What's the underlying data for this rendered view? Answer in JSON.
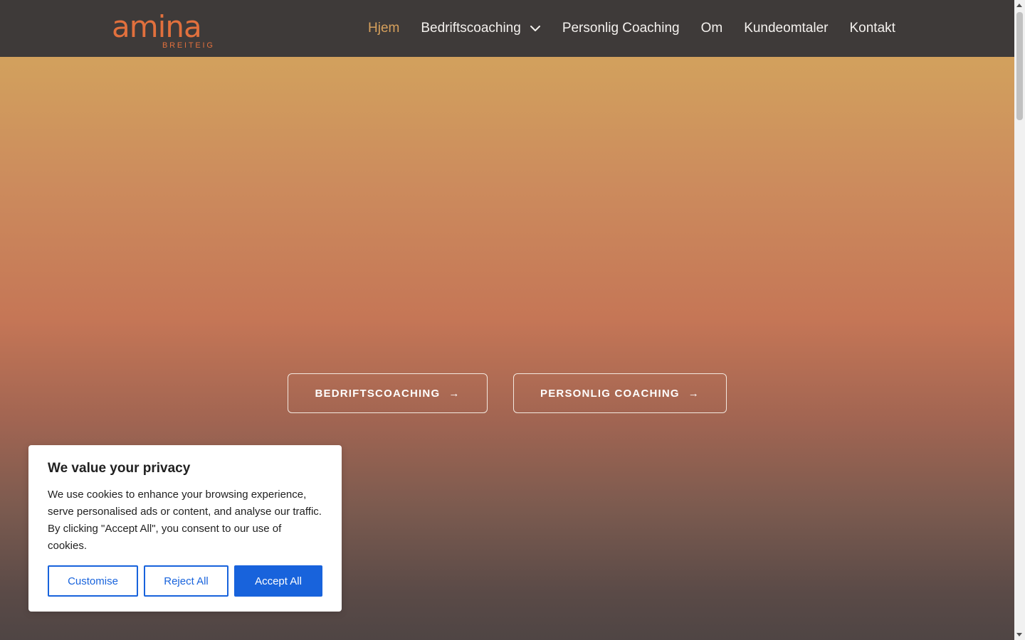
{
  "header": {
    "logo_word": "amina",
    "logo_sub": "BREITEIG",
    "nav": [
      {
        "label": "Hjem",
        "active": true
      },
      {
        "label": "Bedriftscoaching",
        "has_dropdown": true
      },
      {
        "label": "Personlig Coaching"
      },
      {
        "label": "Om"
      },
      {
        "label": "Kundeomtaler"
      },
      {
        "label": "Kontakt"
      }
    ]
  },
  "hero": {
    "cta_business": "BEDRIFTSCOACHING",
    "cta_personal": "PERSONLIG COACHING",
    "arrow_icon": "→"
  },
  "cookie": {
    "title": "We value your privacy",
    "text": "We use cookies to enhance your browsing experience, serve personalised ads or content, and analyse our traffic. By clicking \"Accept All\", you consent to our use of cookies.",
    "customise": "Customise",
    "reject": "Reject All",
    "accept": "Accept All"
  },
  "colors": {
    "brand_orange": "#e2703d",
    "nav_active": "#d6a05c",
    "header_bg": "#3e3a39",
    "cookie_accent": "#1863dc"
  },
  "icons": {
    "dropdown": "chevron-down-icon",
    "cta_arrow": "arrow-right-icon"
  }
}
